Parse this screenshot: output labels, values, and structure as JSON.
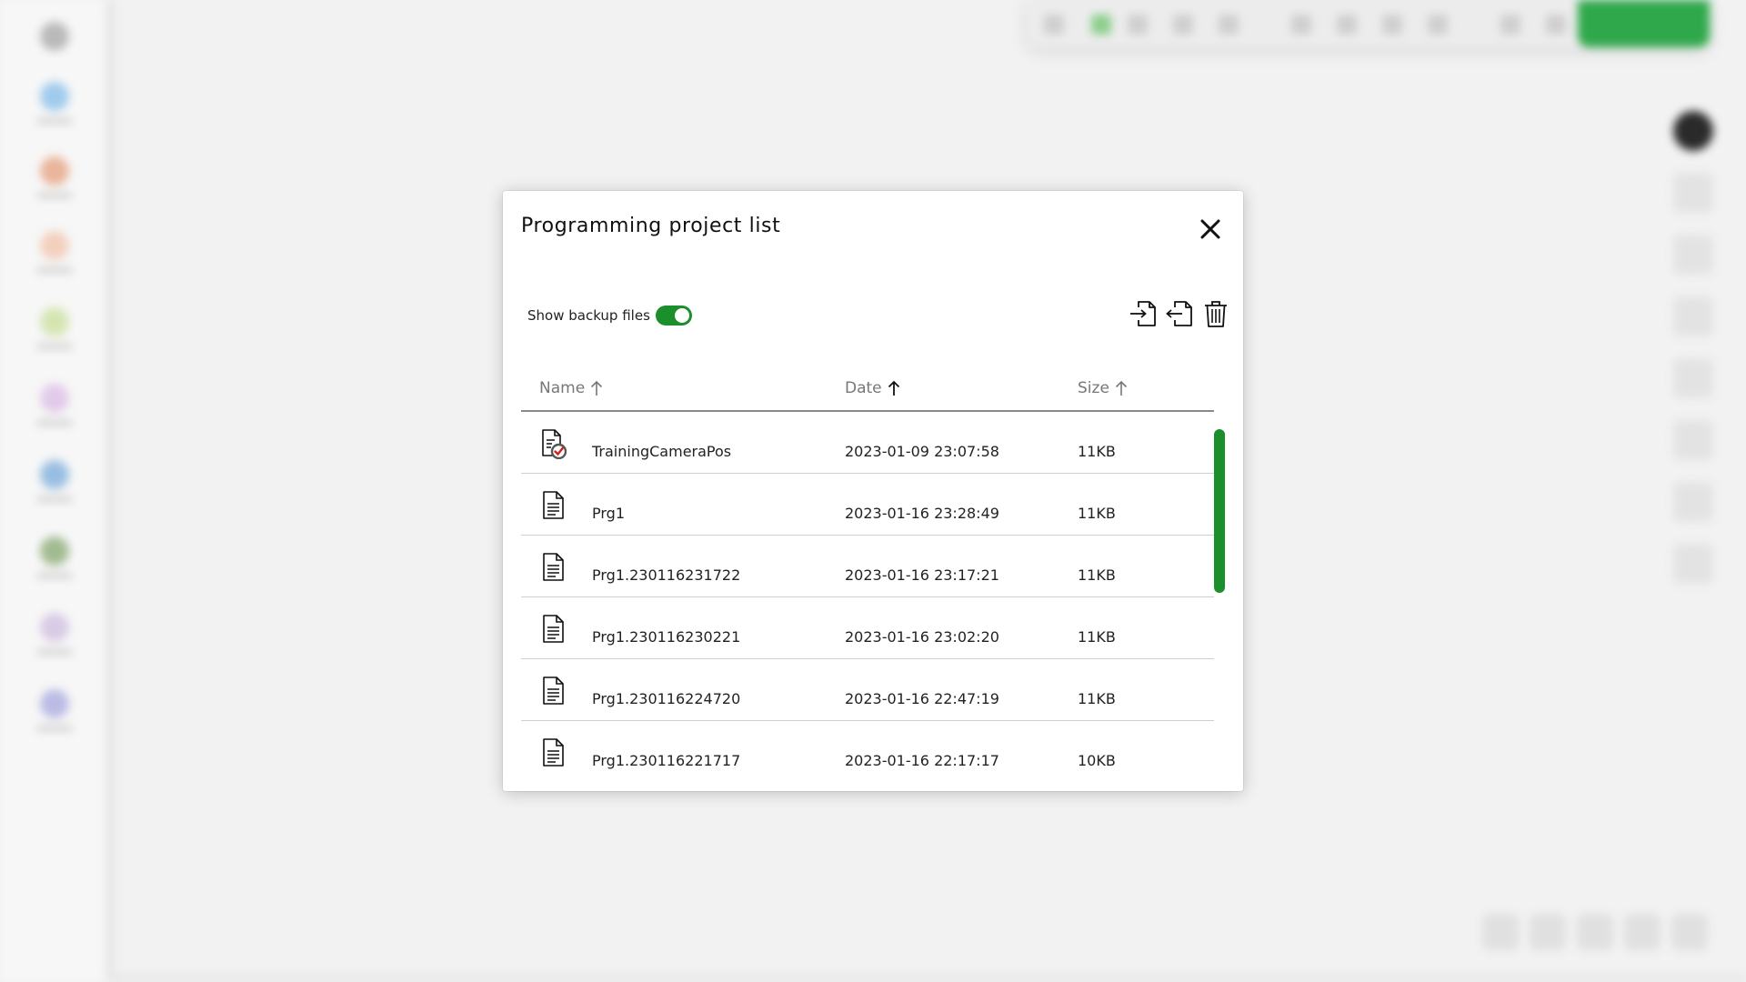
{
  "colors": {
    "accent_green": "#1b8f2c",
    "modal_bg": "#ffffff",
    "header_text": "#777777"
  },
  "modal": {
    "title": "Programming project list",
    "close_icon": "close-icon"
  },
  "backup": {
    "label": "Show backup files",
    "enabled": true
  },
  "actions": [
    {
      "name": "import-icon"
    },
    {
      "name": "export-icon"
    },
    {
      "name": "delete-icon"
    }
  ],
  "table": {
    "columns": [
      {
        "label": "Name",
        "sort": "asc"
      },
      {
        "label": "Date",
        "sort": "asc"
      },
      {
        "label": "Size",
        "sort": "asc"
      }
    ],
    "rows": [
      {
        "name": "TrainingCameraPos",
        "date": "2023-01-09 23:07:58",
        "size": "11KB",
        "icon": "file-check-icon"
      },
      {
        "name": "Prg1",
        "date": "2023-01-16 23:28:49",
        "size": "11KB",
        "icon": "file-icon"
      },
      {
        "name": "Prg1.230116231722",
        "date": "2023-01-16 23:17:21",
        "size": "11KB",
        "icon": "file-icon"
      },
      {
        "name": "Prg1.230116230221",
        "date": "2023-01-16 23:02:20",
        "size": "11KB",
        "icon": "file-icon"
      },
      {
        "name": "Prg1.230116224720",
        "date": "2023-01-16 22:47:19",
        "size": "11KB",
        "icon": "file-icon"
      },
      {
        "name": "Prg1.230116221717",
        "date": "2023-01-16 22:17:17",
        "size": "10KB",
        "icon": "file-icon"
      }
    ]
  }
}
